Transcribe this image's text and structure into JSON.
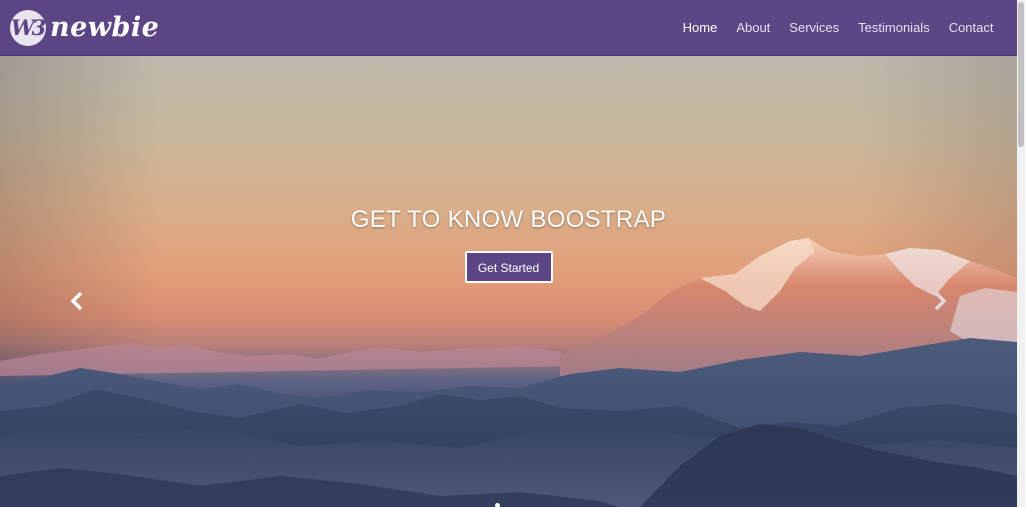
{
  "navbar": {
    "brand": {
      "logo_text": "W3",
      "name": "newbie"
    },
    "items": [
      {
        "label": "Home",
        "active": true
      },
      {
        "label": "About",
        "active": false
      },
      {
        "label": "Services",
        "active": false
      },
      {
        "label": "Testimonials",
        "active": false
      },
      {
        "label": "Contact",
        "active": false
      }
    ],
    "background_color": "#5c4585"
  },
  "hero": {
    "title": "GET TO KNOW BOOSTRAP",
    "cta_label": "Get Started",
    "prev_icon": "chevron-left-icon",
    "next_icon": "chevron-right-icon",
    "accent_color": "#5c4585"
  }
}
